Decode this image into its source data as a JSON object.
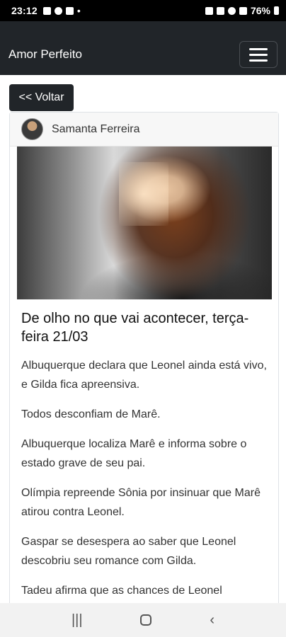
{
  "status_bar": {
    "time": "23:12",
    "battery": "76%",
    "extra_dot": "•"
  },
  "navbar": {
    "brand": "Amor Perfeito"
  },
  "back_button": {
    "label": "<< Voltar"
  },
  "post": {
    "author": "Samanta Ferreira",
    "title": "De olho no que vai acontecer, terça-feira 21/03",
    "paragraphs": [
      "Albuquerque declara que Leonel ainda está vivo, e Gilda fica apreensiva.",
      "Todos desconfiam de Marê.",
      "Albuquerque localiza Marê e informa sobre o estado grave de seu pai.",
      "Olímpia repreende Sônia por insinuar que Marê atirou contra Leonel.",
      "Gaspar se desespera ao saber que Leonel descobriu seu romance com Gilda.",
      "Tadeu afirma que as chances de Leonel sobreviver são pequenas e Gaspar fica"
    ]
  },
  "system_nav": {
    "recents": "|||",
    "back": "‹"
  },
  "icons": [
    "gallery-icon",
    "facebook-icon",
    "notification-icon",
    "alarm-icon",
    "mute-icon",
    "wifi-icon",
    "signal-icon",
    "battery-icon",
    "menu-icon"
  ]
}
